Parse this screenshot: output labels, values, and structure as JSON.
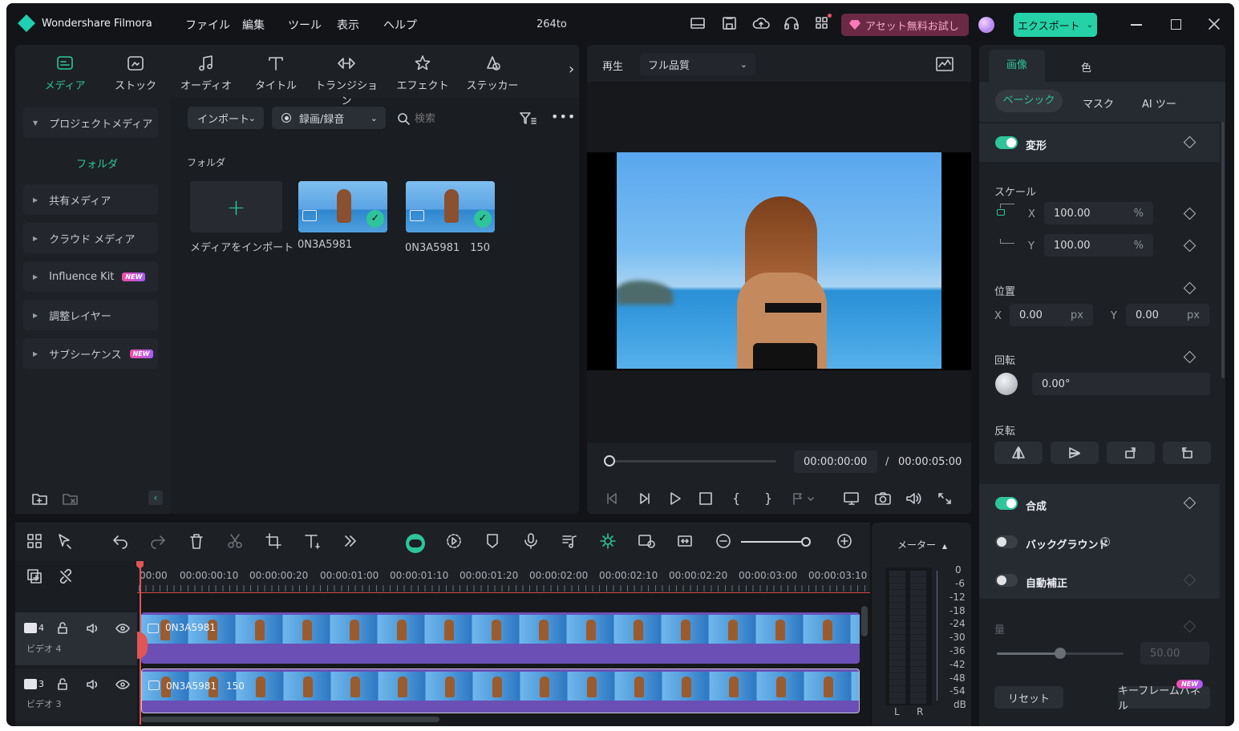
{
  "app": {
    "title": "Wondershare Filmora",
    "project": "264to",
    "export_label": "エクスポート",
    "promo_label": "アセット無料お試し"
  },
  "menus": [
    "ファイル",
    "編集",
    "ツール",
    "表示",
    "ヘルプ"
  ],
  "media_tabs": [
    "メディア",
    "ストック",
    "オーディオ",
    "タイトル",
    "トランジション",
    "エフェクト",
    "ステッカー"
  ],
  "sidebar": {
    "project_media": "プロジェクトメディア",
    "folder": "フォルダ",
    "items": [
      "共有メディア",
      "クラウド メディア",
      "Influence Kit",
      "調整レイヤー",
      "サブシーケンス"
    ],
    "new_badge": "NEW"
  },
  "media_toolbar": {
    "import": "インポート",
    "record": "録画/録音",
    "search_placeholder": "検索"
  },
  "library": {
    "folder_heading": "フォルダ",
    "import_tile": "メディアをインポート",
    "clips": [
      "0N3A5981",
      "0N3A5981　150"
    ]
  },
  "preview": {
    "play_label": "再生",
    "quality": "フル品質",
    "current_time": "00:00:00:00",
    "separator": "/",
    "total_time": "00:00:05:00"
  },
  "props": {
    "tabs": [
      "画像",
      "色"
    ],
    "subtabs": [
      "ベーシック",
      "マスク",
      "AI ツー"
    ],
    "transform": "変形",
    "scale": "スケール",
    "scale_x": "100.00",
    "scale_y": "100.00",
    "percent": "%",
    "position": "位置",
    "pos_x": "0.00",
    "pos_y": "0.00",
    "px": "px",
    "x": "X",
    "y": "Y",
    "rotation": "回転",
    "rotation_value": "0.00°",
    "flip": "反転",
    "composite": "合成",
    "background": "バックグラウンド",
    "auto_enhance": "自動補正",
    "amount": "量",
    "amount_value": "50.00",
    "reset": "リセット",
    "keyframe_panel": "キーフレームパネル",
    "new_badge": "NEW"
  },
  "timeline": {
    "ruler": [
      "00:00",
      "00:00:00:10",
      "00:00:00:20",
      "00:00:01:00",
      "00:00:01:10",
      "00:00:01:20",
      "00:00:02:00",
      "00:00:02:10",
      "00:00:02:20",
      "00:00:03:00",
      "00:00:03:10"
    ],
    "tracks": [
      {
        "num": "4",
        "name": "ビデオ 4",
        "clip": "0N3A5981"
      },
      {
        "num": "3",
        "name": "ビデオ 3",
        "clip": "0N3A5981　150"
      }
    ]
  },
  "meter": {
    "title": "メーター",
    "scale": [
      "0",
      "-6",
      "-12",
      "-18",
      "-24",
      "-30",
      "-36",
      "-42",
      "-48",
      "-54",
      "dB"
    ],
    "left": "L",
    "right": "R"
  },
  "colors": {
    "accent": "#2ec59a",
    "background": "#121418",
    "panel": "#1d2025",
    "clip": "#6b4fb5"
  }
}
